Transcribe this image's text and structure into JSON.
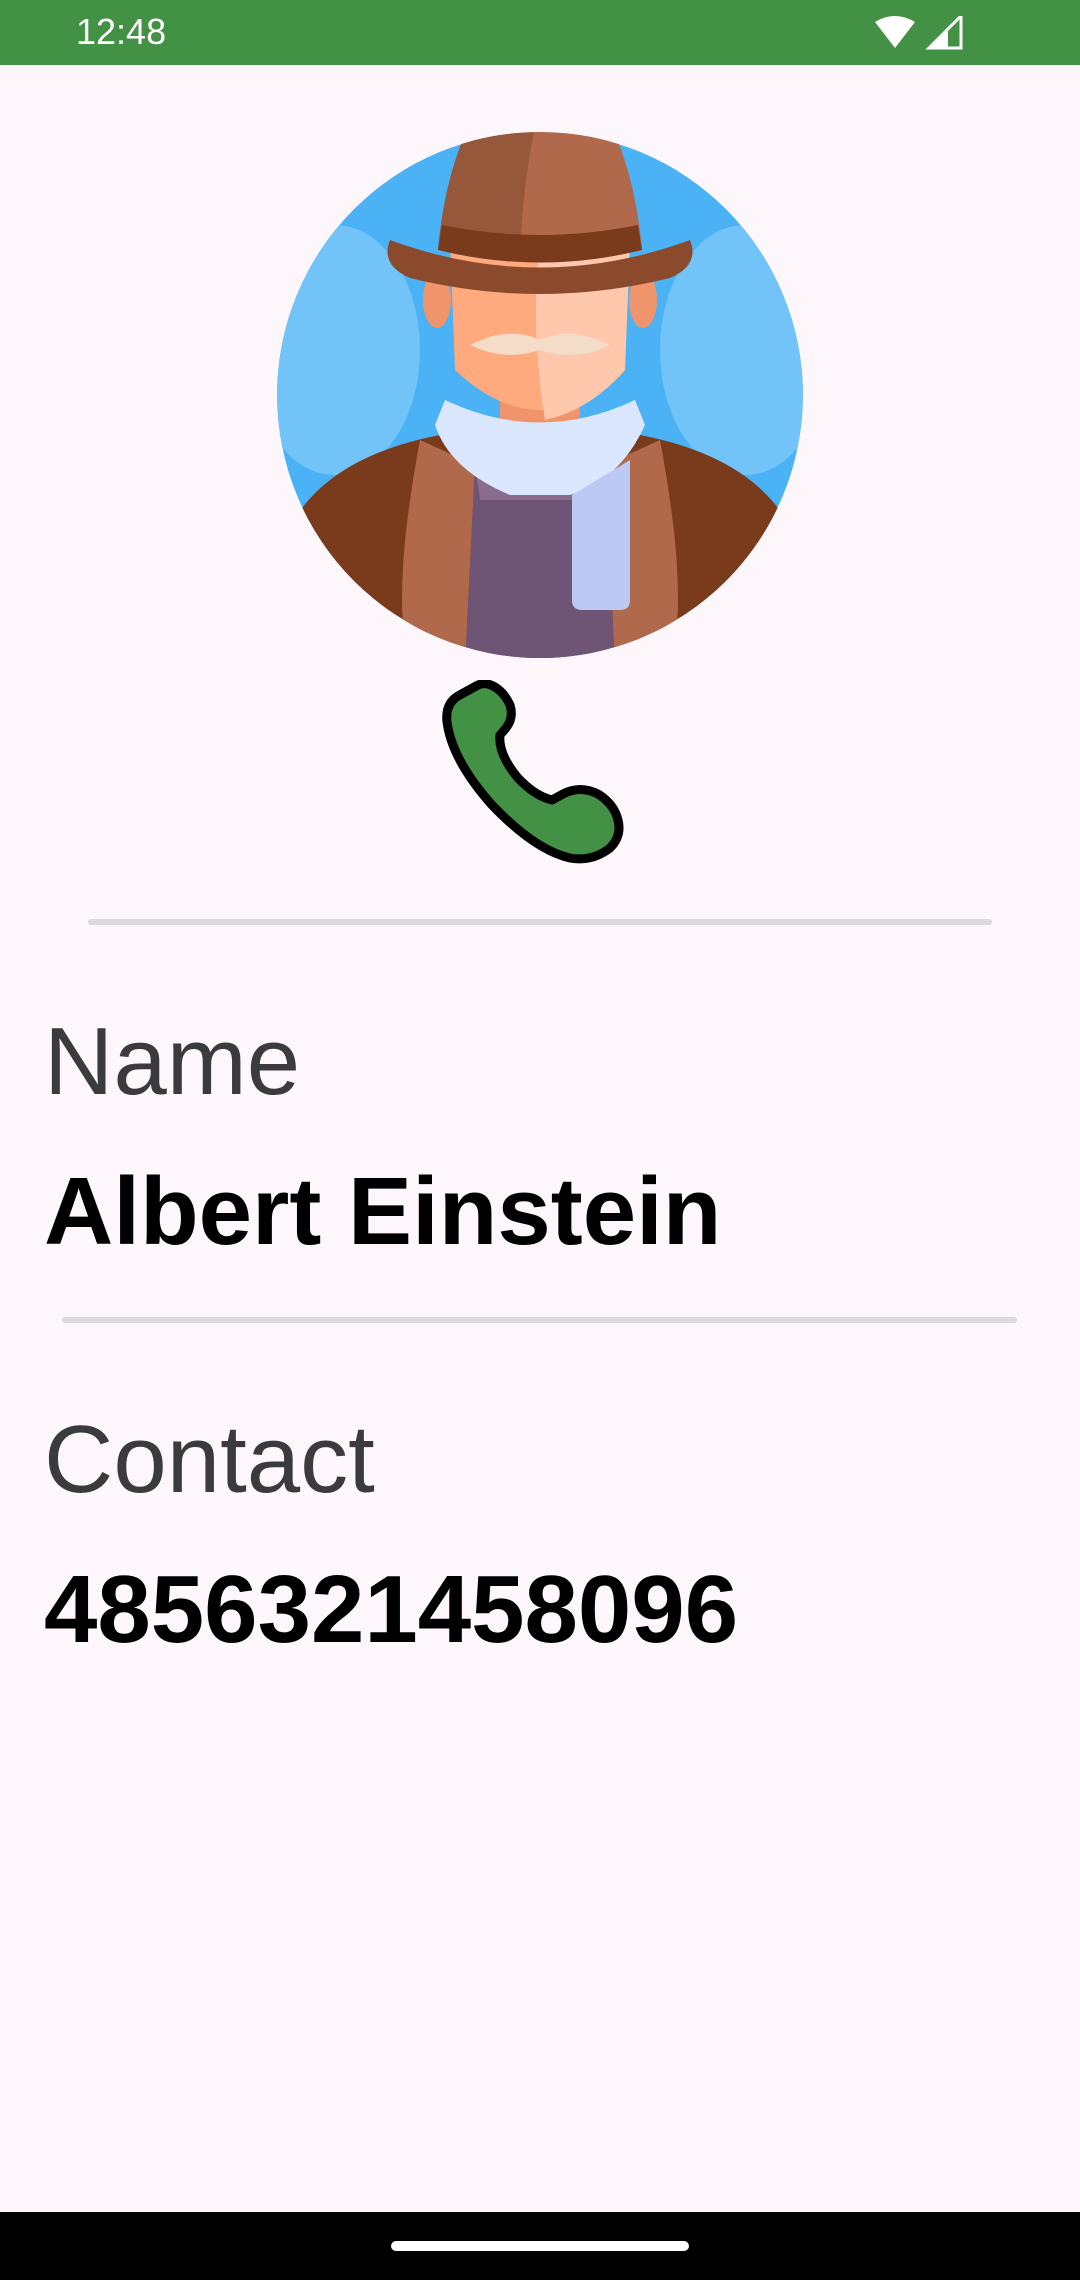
{
  "status_bar": {
    "time": "12:48",
    "icons": [
      "wifi-icon",
      "signal-icon"
    ]
  },
  "contact": {
    "avatar_icon": "man-with-hat-avatar",
    "call_icon": "phone-icon",
    "name_label": "Name",
    "name_value": "Albert Einstein",
    "contact_label": "Contact",
    "contact_value": "4856321458096"
  },
  "colors": {
    "status_bar": "#439144",
    "background": "#fdf7fc",
    "phone_icon": "#439144",
    "avatar_bg": "#4ab2f5"
  }
}
